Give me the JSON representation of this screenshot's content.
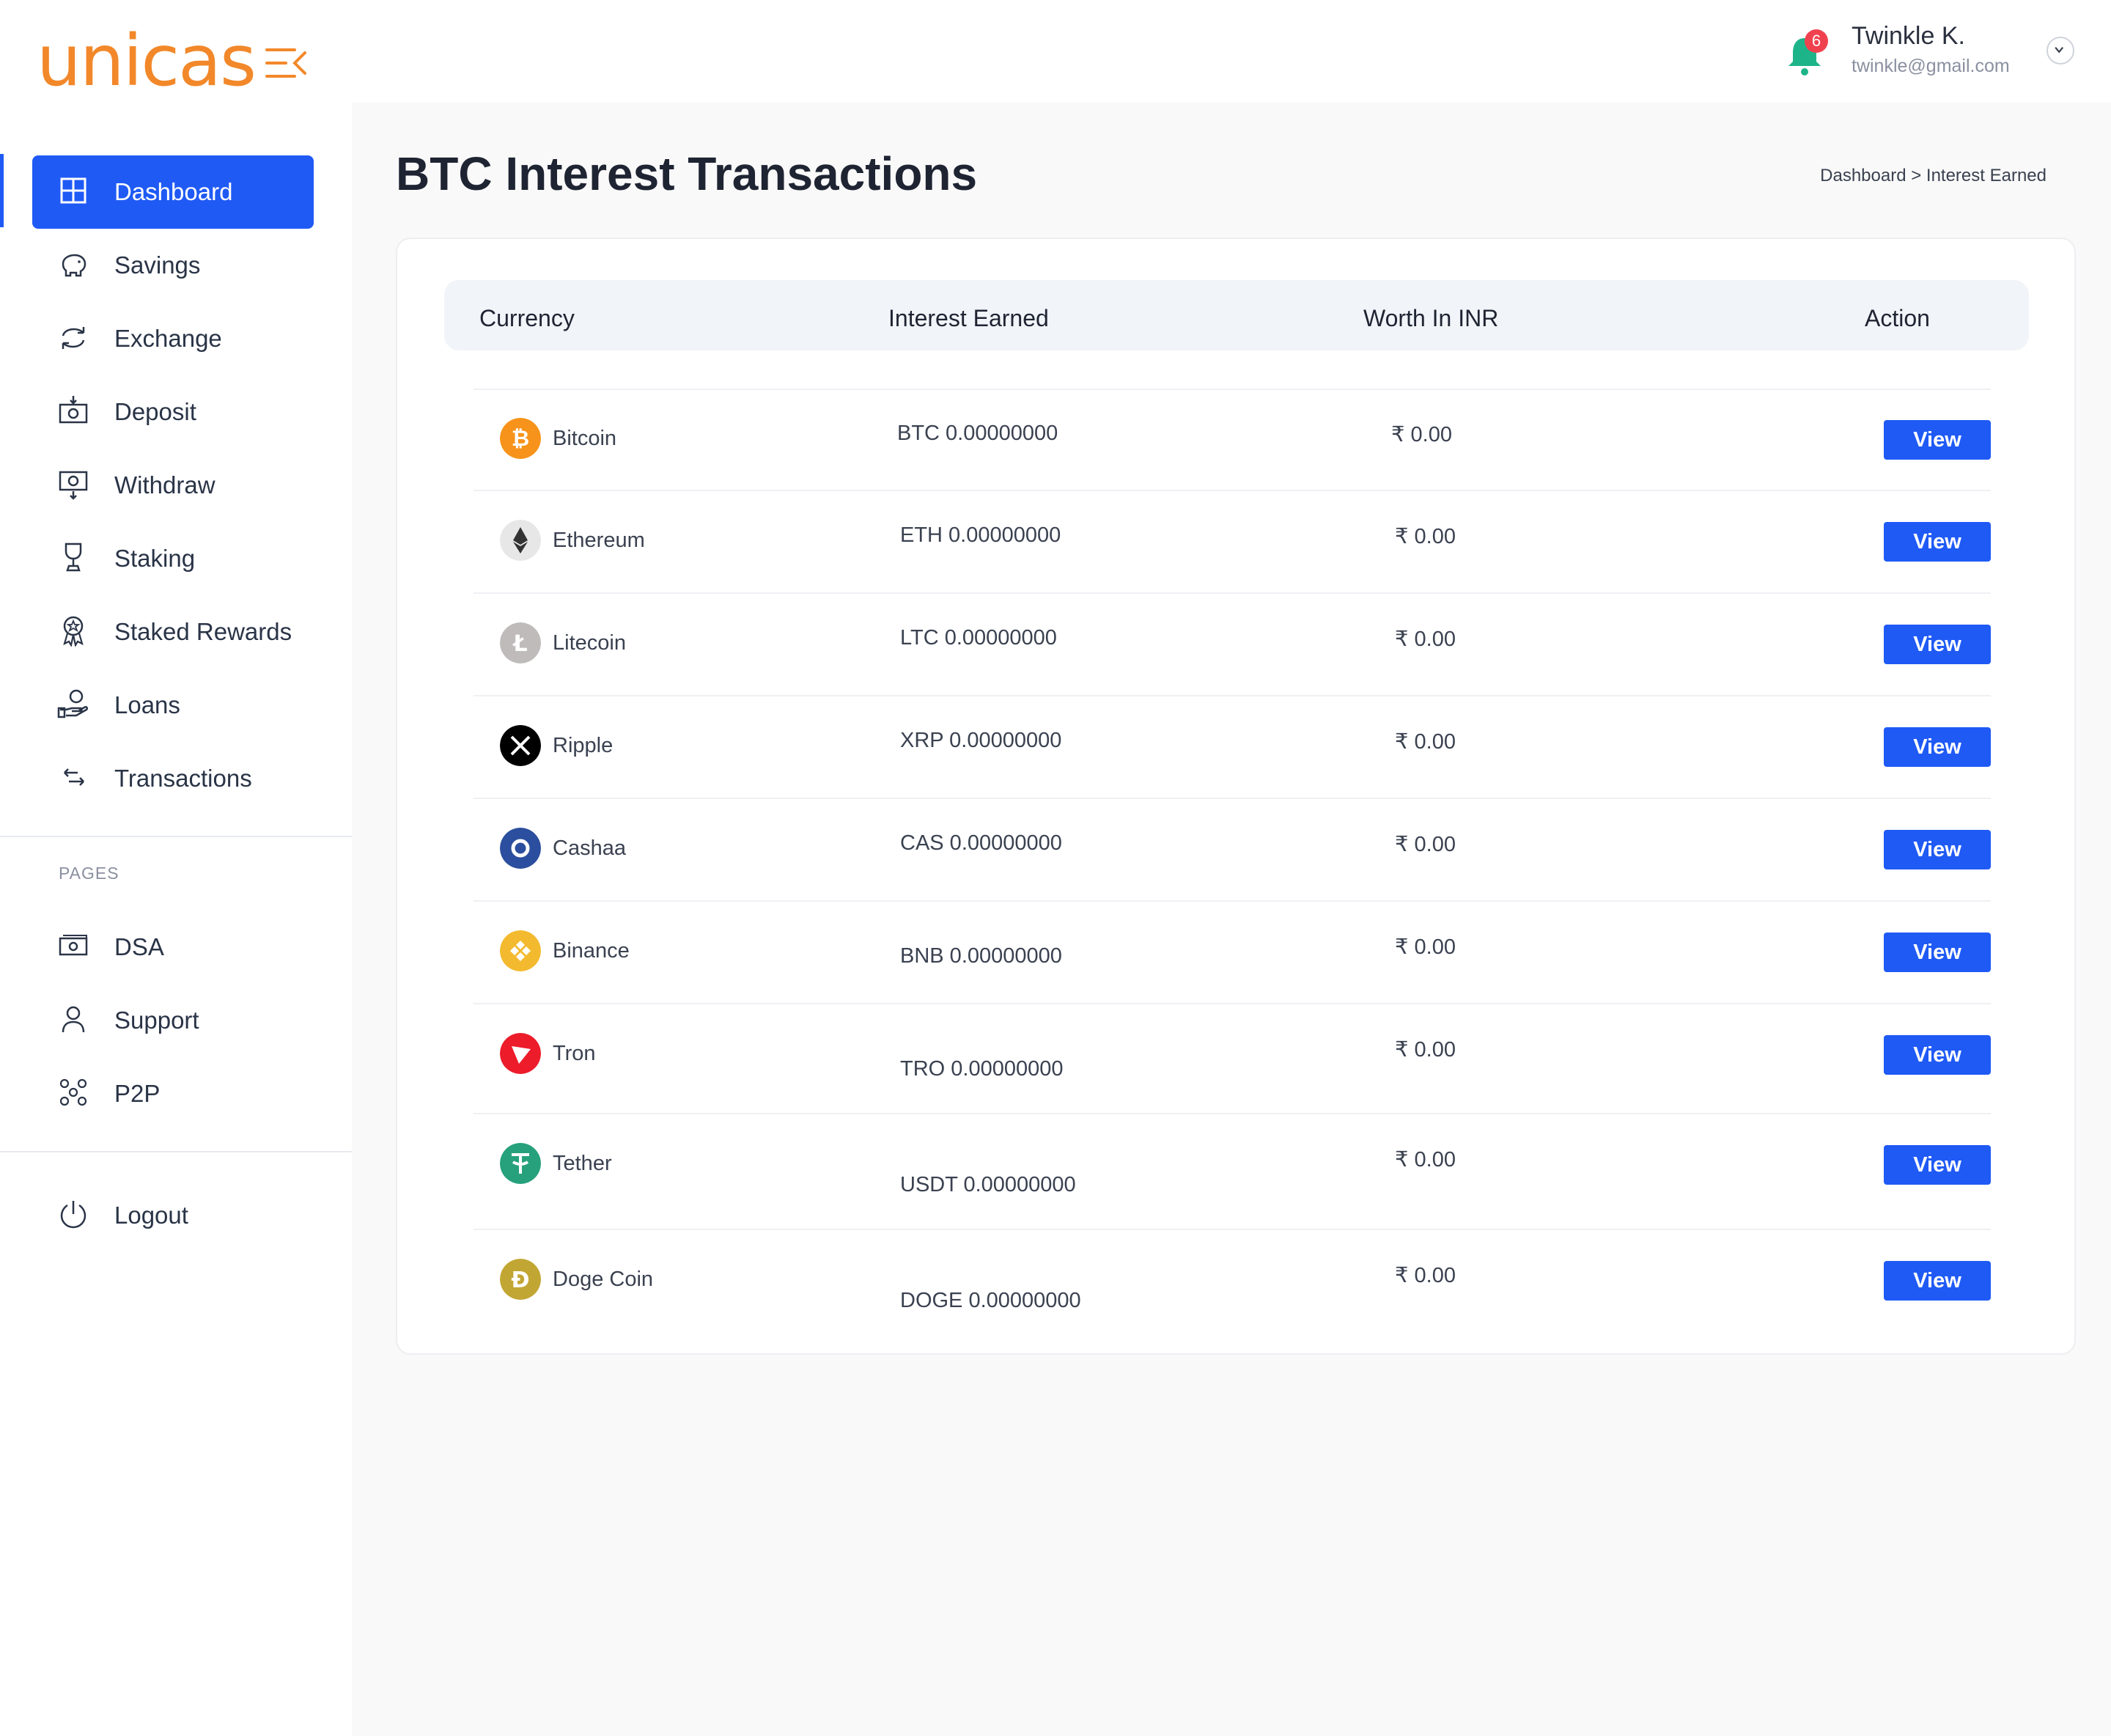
{
  "header": {
    "logo_text": "unicas",
    "notification_count": "6",
    "user_name": "Twinkle K.",
    "user_email": "twinkle@gmail.com",
    "brand_color": "#f2882a",
    "accent_color": "#1f5af5"
  },
  "sidebar": {
    "items": [
      {
        "label": "Dashboard",
        "icon": "grid-icon",
        "active": true
      },
      {
        "label": "Savings",
        "icon": "piggy-bank-icon"
      },
      {
        "label": "Exchange",
        "icon": "exchange-icon"
      },
      {
        "label": "Deposit",
        "icon": "deposit-icon"
      },
      {
        "label": "Withdraw",
        "icon": "withdraw-icon"
      },
      {
        "label": "Staking",
        "icon": "trophy-icon"
      },
      {
        "label": "Staked Rewards",
        "icon": "medal-icon"
      },
      {
        "label": "Loans",
        "icon": "hand-coin-icon"
      },
      {
        "label": "Transactions",
        "icon": "arrows-icon"
      }
    ],
    "pages_heading": "PAGES",
    "pages": [
      {
        "label": "DSA",
        "icon": "cash-icon"
      },
      {
        "label": "Support",
        "icon": "user-icon"
      },
      {
        "label": "P2P",
        "icon": "group-icon"
      }
    ],
    "logout_label": "Logout"
  },
  "main": {
    "title": "BTC Interest Transactions",
    "breadcrumb": "Dashboard > Interest Earned",
    "table": {
      "headers": [
        "Currency",
        "Interest Earned",
        "Worth In INR",
        "Action"
      ],
      "rows": [
        {
          "name": "Bitcoin",
          "amount": "BTC 0.00000000",
          "inr": "₹ 0.00",
          "action": "View",
          "color": "#f7931a"
        },
        {
          "name": "Ethereum",
          "amount": "ETH 0.00000000",
          "inr": "₹ 0.00",
          "action": "View",
          "color": "#e7e7e7"
        },
        {
          "name": "Litecoin",
          "amount": "LTC 0.00000000",
          "inr": "₹ 0.00",
          "action": "View",
          "color": "#bfbbbb"
        },
        {
          "name": "Ripple",
          "amount": "XRP 0.00000000",
          "inr": "₹ 0.00",
          "action": "View",
          "color": "#000000"
        },
        {
          "name": "Cashaa",
          "amount": "CAS 0.00000000",
          "inr": "₹ 0.00",
          "action": "View",
          "color": "#2b4f9e"
        },
        {
          "name": "Binance",
          "amount": "BNB 0.00000000",
          "inr": "₹ 0.00",
          "action": "View",
          "color": "#f3ba2f"
        },
        {
          "name": "Tron",
          "amount": "TRO 0.00000000",
          "inr": "₹ 0.00",
          "action": "View",
          "color": "#ec1c2b"
        },
        {
          "name": "Tether",
          "amount": "USDT 0.00000000",
          "inr": "₹ 0.00",
          "action": "View",
          "color": "#26a17b"
        },
        {
          "name": "Doge Coin",
          "amount": "DOGE 0.00000000",
          "inr": "₹ 0.00",
          "action": "View",
          "color": "#c2a633"
        }
      ]
    }
  }
}
